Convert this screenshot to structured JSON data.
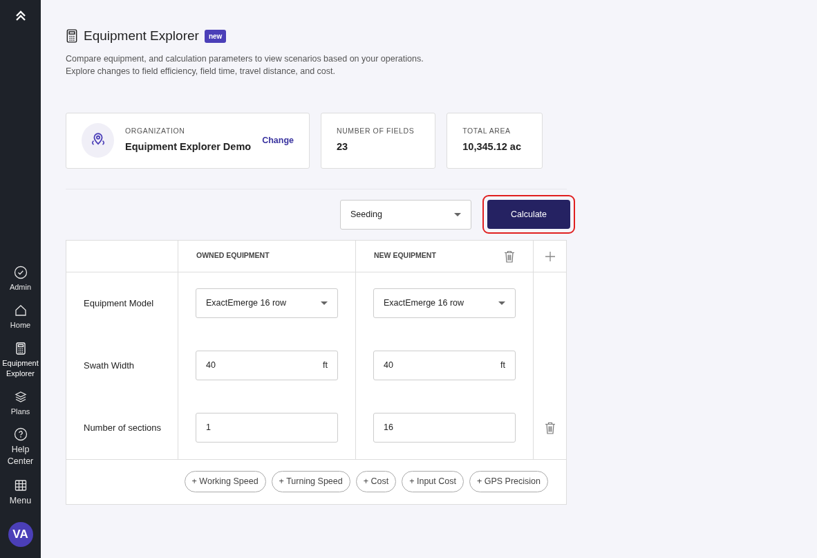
{
  "sidebar": {
    "items": [
      {
        "label": "Admin",
        "selected": false
      },
      {
        "label": "Home",
        "selected": false
      },
      {
        "label": "Equipment Explorer",
        "selected": true
      },
      {
        "label": "Plans",
        "selected": false
      },
      {
        "label": "Help Center",
        "selected": false
      },
      {
        "label": "Menu",
        "selected": false
      }
    ],
    "avatar": "VA"
  },
  "header": {
    "title": "Equipment Explorer",
    "badge": "new",
    "description": [
      "Compare equipment, and calculation parameters to view scenarios based on your operations.",
      "Explore changes to field efficiency, field time, travel distance, and cost."
    ]
  },
  "stats": [
    {
      "kind": "org",
      "label": "ORGANIZATION",
      "value": "Equipment Explorer Demo",
      "action": "Change"
    },
    {
      "kind": "plain",
      "label": "NUMBER OF FIELDS",
      "value": "23"
    },
    {
      "kind": "plain",
      "label": "TOTAL AREA",
      "value": "10,345.12 ac"
    }
  ],
  "operation": {
    "value": "Seeding"
  },
  "calculate": {
    "label": "Calculate",
    "highlighted": true
  },
  "table": {
    "columns": [
      "OWNED EQUIPMENT",
      "NEW EQUIPMENT"
    ],
    "rows": [
      {
        "label": "Equipment Model",
        "kind": "select",
        "values": [
          "ExactEmerge 16 row",
          "ExactEmerge 16 row"
        ],
        "deletable": false
      },
      {
        "label": "Swath Width",
        "kind": "unit",
        "units": [
          "ft",
          "ft"
        ],
        "values": [
          "40",
          "40"
        ],
        "deletable": false
      },
      {
        "label": "Number of sections",
        "kind": "number",
        "values": [
          "1",
          "16"
        ],
        "deletable": true
      }
    ],
    "add_buttons": [
      "+ Working Speed",
      "+ Turning Speed",
      "+ Cost",
      "+ Input Cost",
      "+ GPS Precision"
    ]
  }
}
